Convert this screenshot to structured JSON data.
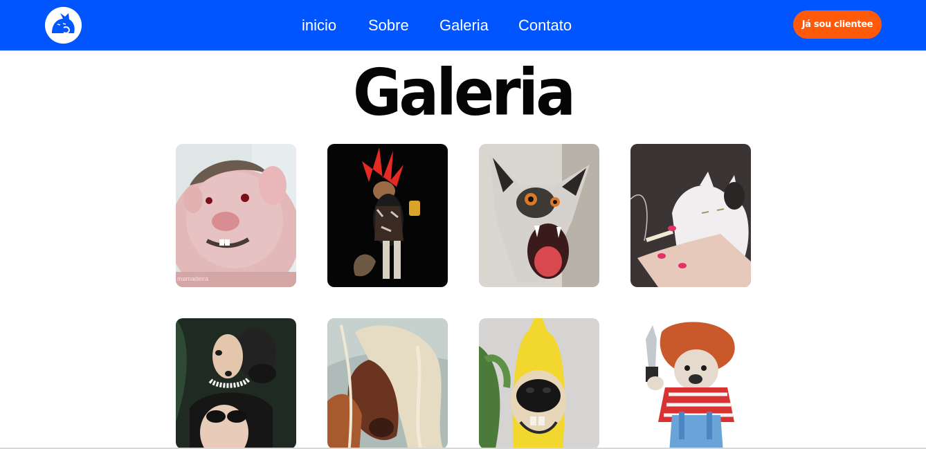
{
  "header": {
    "logo_icon": "cat-logo-icon",
    "nav": [
      {
        "label": "inicio"
      },
      {
        "label": "Sobre"
      },
      {
        "label": "Galeria"
      },
      {
        "label": "Contato"
      }
    ],
    "cta_label": "Já sou clientee"
  },
  "main": {
    "title": "Galeria",
    "gallery": [
      {
        "subject": "hairless rat with hairstyle",
        "caption": "mamadeira"
      },
      {
        "subject": "punk squirrel with red mohawk"
      },
      {
        "subject": "screaming wet cat"
      },
      {
        "subject": "white cat with cigarette"
      },
      {
        "subject": "chihuahua with pearl necklace"
      },
      {
        "subject": "horse with blonde wig"
      },
      {
        "subject": "dog in banana costume"
      },
      {
        "subject": "bulldog in chucky costume"
      }
    ]
  },
  "colors": {
    "navbar": "#0055ff",
    "cta": "#ff5a0a",
    "title": "#050505"
  }
}
